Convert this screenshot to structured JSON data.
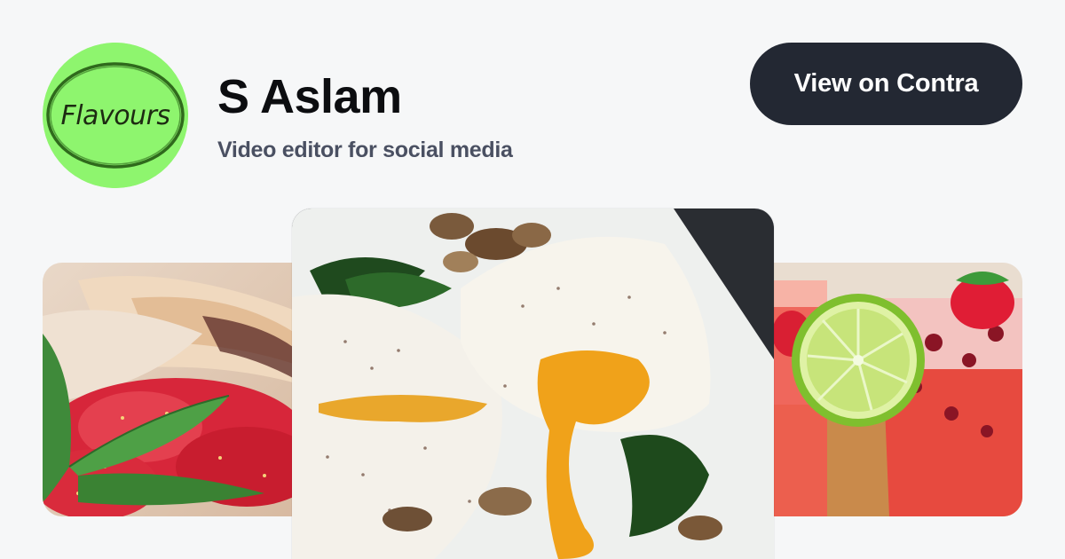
{
  "profile": {
    "avatar_text": "Flavours",
    "name": "S Aslam",
    "tagline": "Video editor for social media"
  },
  "actions": {
    "view_button": "View on Contra"
  },
  "gallery": {
    "items": [
      {
        "subject": "strawberries with flatbread"
      },
      {
        "subject": "fried eggs with spinach and mushrooms"
      },
      {
        "subject": "strawberry lime drinks"
      }
    ]
  },
  "colors": {
    "background": "#f6f7f8",
    "avatar_bg": "#8ef56e",
    "button_bg": "#232833",
    "button_text": "#ffffff",
    "name_text": "#0c0d10",
    "tagline_text": "#4a5062"
  },
  "icons": [
    "flavours-logo"
  ]
}
